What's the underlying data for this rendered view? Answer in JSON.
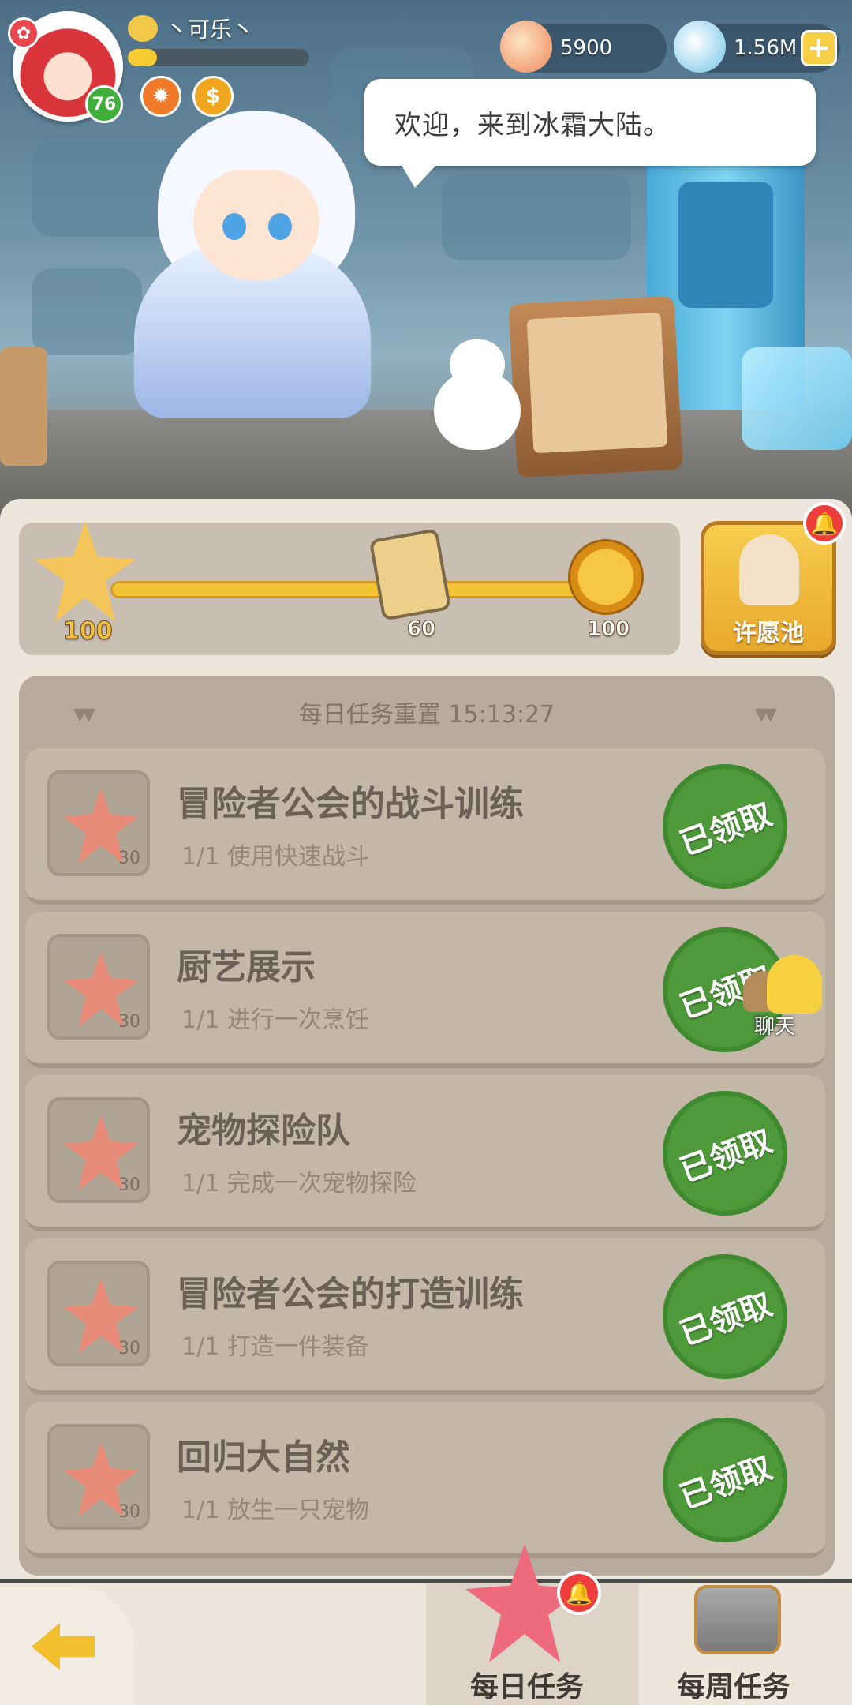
{
  "player": {
    "name": "丶可乐丶",
    "level": "76",
    "exp_fraction": 0.16
  },
  "currency": {
    "shell": "5900",
    "gem": "1.56M",
    "add_symbol": "+"
  },
  "npc": {
    "speech": "欢迎，来到冰霜大陆。"
  },
  "rewards": {
    "milestones": [
      {
        "label": "100",
        "icon": "star-chest-icon"
      },
      {
        "label": "60",
        "icon": "card-icon"
      },
      {
        "label": "100",
        "icon": "gold-coin-icon"
      }
    ],
    "wish_pool_label": "许愿池"
  },
  "daily_reset": {
    "label": "每日任务重置 15:13:27"
  },
  "tasks": [
    {
      "title": "冒险者公会的战斗训练",
      "desc": "1/1 使用快速战斗",
      "qty": "30",
      "status": "已领取"
    },
    {
      "title": "厨艺展示",
      "desc": "1/1 进行一次烹饪",
      "qty": "30",
      "status": "已领取"
    },
    {
      "title": "宠物探险队",
      "desc": "1/1 完成一次宠物探险",
      "qty": "30",
      "status": "已领取"
    },
    {
      "title": "冒险者公会的打造训练",
      "desc": "1/1 打造一件装备",
      "qty": "30",
      "status": "已领取"
    },
    {
      "title": "回归大自然",
      "desc": "1/1 放生一只宠物",
      "qty": "30",
      "status": "已领取"
    }
  ],
  "chat": {
    "label": "聊天"
  },
  "nav": {
    "daily": "每日任务",
    "weekly": "每周任务"
  },
  "colors": {
    "accent_gold": "#f2c333",
    "claimed_green": "#4e9a3a",
    "alert_red": "#ee3d3d"
  }
}
